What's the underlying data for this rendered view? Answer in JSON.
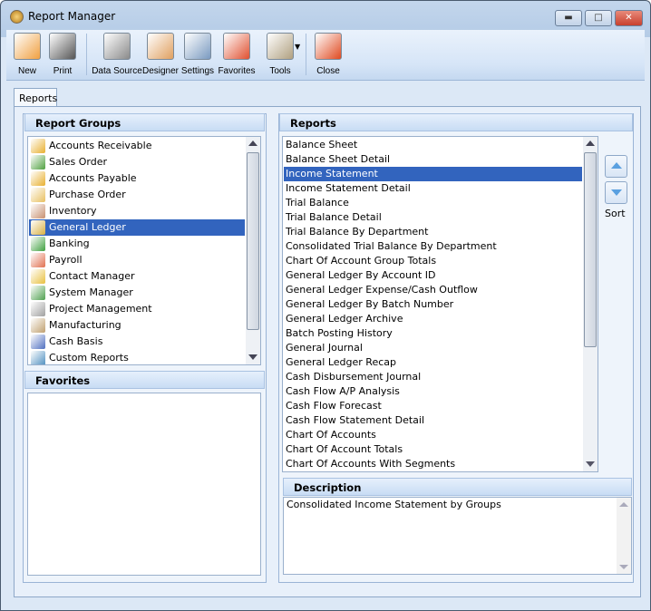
{
  "window": {
    "title": "Report Manager"
  },
  "toolbar": [
    {
      "label": "New",
      "icon": "new-report-icon",
      "color": "#f0a040"
    },
    {
      "label": "Print",
      "icon": "printer-icon",
      "color": "#555555"
    },
    {
      "label": "Data Source",
      "icon": "database-icon",
      "color": "#8a8a8a"
    },
    {
      "label": "Designer",
      "icon": "designer-icon",
      "color": "#e0a060"
    },
    {
      "label": "Settings",
      "icon": "settings-icon",
      "color": "#7a9ac0"
    },
    {
      "label": "Favorites",
      "icon": "favorites-icon",
      "color": "#e05030"
    },
    {
      "label": "Tools",
      "icon": "tools-icon",
      "color": "#b0a080"
    },
    {
      "label": "Close",
      "icon": "close-report-icon",
      "color": "#e04a20"
    }
  ],
  "tabs": [
    {
      "label": "Reports",
      "active": true
    }
  ],
  "report_groups": {
    "header": "Report Groups",
    "selected": "General Ledger",
    "items": [
      {
        "label": "Accounts Receivable",
        "icon": "accounts-receivable-icon",
        "color": "#e8b030"
      },
      {
        "label": "Sales Order",
        "icon": "sales-order-icon",
        "color": "#50a040"
      },
      {
        "label": "Accounts Payable",
        "icon": "accounts-payable-icon",
        "color": "#e8b030"
      },
      {
        "label": "Purchase Order",
        "icon": "purchase-order-icon",
        "color": "#e8c060"
      },
      {
        "label": "Inventory",
        "icon": "inventory-icon",
        "color": "#c89070"
      },
      {
        "label": "General Ledger",
        "icon": "general-ledger-icon",
        "color": "#d8b040"
      },
      {
        "label": "Banking",
        "icon": "banking-icon",
        "color": "#40a040"
      },
      {
        "label": "Payroll",
        "icon": "payroll-icon",
        "color": "#e07050"
      },
      {
        "label": "Contact Manager",
        "icon": "contact-manager-icon",
        "color": "#e8c040"
      },
      {
        "label": "System Manager",
        "icon": "system-manager-icon",
        "color": "#50a050"
      },
      {
        "label": "Project Management",
        "icon": "project-management-icon",
        "color": "#a0a0a0"
      },
      {
        "label": "Manufacturing",
        "icon": "manufacturing-icon",
        "color": "#c0a070"
      },
      {
        "label": "Cash Basis",
        "icon": "cash-basis-icon",
        "color": "#5070c0"
      },
      {
        "label": "Custom Reports",
        "icon": "custom-reports-icon",
        "color": "#5090c0"
      }
    ]
  },
  "favorites": {
    "header": "Favorites",
    "items": []
  },
  "reports": {
    "header": "Reports",
    "selected": "Income Statement",
    "items": [
      "Balance Sheet",
      "Balance Sheet Detail",
      "Income Statement",
      "Income Statement Detail",
      "Trial Balance",
      "Trial Balance Detail",
      "Trial Balance By Department",
      "Consolidated Trial Balance By Department",
      "Chart Of Account Group Totals",
      "General Ledger By Account ID",
      "General Ledger Expense/Cash Outflow",
      "General Ledger By Batch Number",
      "General Ledger Archive",
      "Batch Posting History",
      "General Journal",
      "General Ledger Recap",
      "Cash Disbursement Journal",
      "Cash Flow A/P Analysis",
      "Cash Flow Forecast",
      "Cash Flow Statement Detail",
      "Chart Of Accounts",
      "Chart Of Account Totals",
      "Chart Of Accounts With Segments"
    ]
  },
  "sort": {
    "label": "Sort"
  },
  "description": {
    "header": "Description",
    "text": "Consolidated Income Statement by Groups"
  },
  "colors": {
    "selection": "#3264be",
    "close_button": "#d0483a"
  }
}
